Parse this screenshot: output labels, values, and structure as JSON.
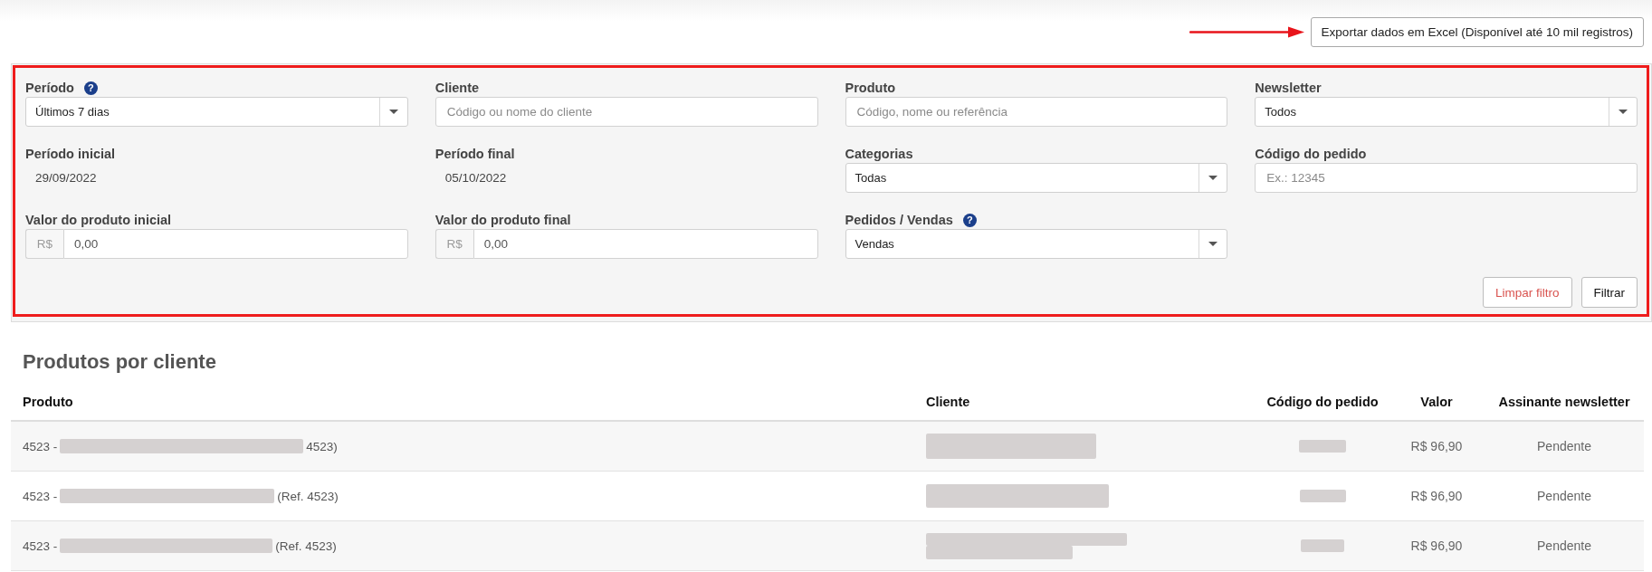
{
  "export_button": {
    "label": "Exportar dados em Excel (Disponível até 10 mil registros)"
  },
  "filters": {
    "fields": [
      {
        "kind": "select",
        "label": "Período",
        "help": "?",
        "value": "Últimos 7 dias"
      },
      {
        "kind": "text",
        "label": "Cliente",
        "placeholder": "Código ou nome do cliente"
      },
      {
        "kind": "text",
        "label": "Produto",
        "placeholder": "Código, nome ou referência"
      },
      {
        "kind": "select",
        "label": "Newsletter",
        "value": "Todos"
      },
      {
        "kind": "static",
        "label": "Período inicial",
        "value": "29/09/2022"
      },
      {
        "kind": "static",
        "label": "Período final",
        "value": "05/10/2022"
      },
      {
        "kind": "select",
        "label": "Categorias",
        "value": "Todas"
      },
      {
        "kind": "text",
        "label": "Código do pedido",
        "placeholder": "Ex.: 12345"
      },
      {
        "kind": "currency",
        "label": "Valor do produto inicial",
        "prefix": "R$",
        "value": "0,00"
      },
      {
        "kind": "currency",
        "label": "Valor do produto final",
        "prefix": "R$",
        "value": "0,00"
      },
      {
        "kind": "select",
        "label": "Pedidos / Vendas",
        "help": "?",
        "value": "Vendas"
      }
    ],
    "actions": [
      {
        "kind": "reset",
        "label": "Limpar filtro"
      },
      {
        "kind": "submit",
        "label": "Filtrar"
      }
    ]
  },
  "table": {
    "title": "Produtos por cliente",
    "columns": [
      "Produto",
      "Cliente",
      "Código do pedido",
      "Valor",
      "Assinante newsletter"
    ],
    "rows": [
      {
        "product": {
          "prefix": "4523 -",
          "redacted": true,
          "suffix": "4523)"
        },
        "client": {
          "redacted": true
        },
        "order_code": {
          "redacted": true
        },
        "value": "R$ 96,90",
        "newsletter": "Pendente"
      },
      {
        "product": {
          "prefix": "4523 -",
          "redacted": true,
          "suffix": "(Ref. 4523)"
        },
        "client": {
          "redacted": true
        },
        "order_code": {
          "redacted": true
        },
        "value": "R$ 96,90",
        "newsletter": "Pendente"
      },
      {
        "product": {
          "prefix": "4523 -",
          "redacted": true,
          "suffix": "(Ref. 4523)"
        },
        "client": {
          "redacted": true
        },
        "order_code": {
          "redacted": true
        },
        "value": "R$ 96,90",
        "newsletter": "Pendente"
      }
    ]
  }
}
